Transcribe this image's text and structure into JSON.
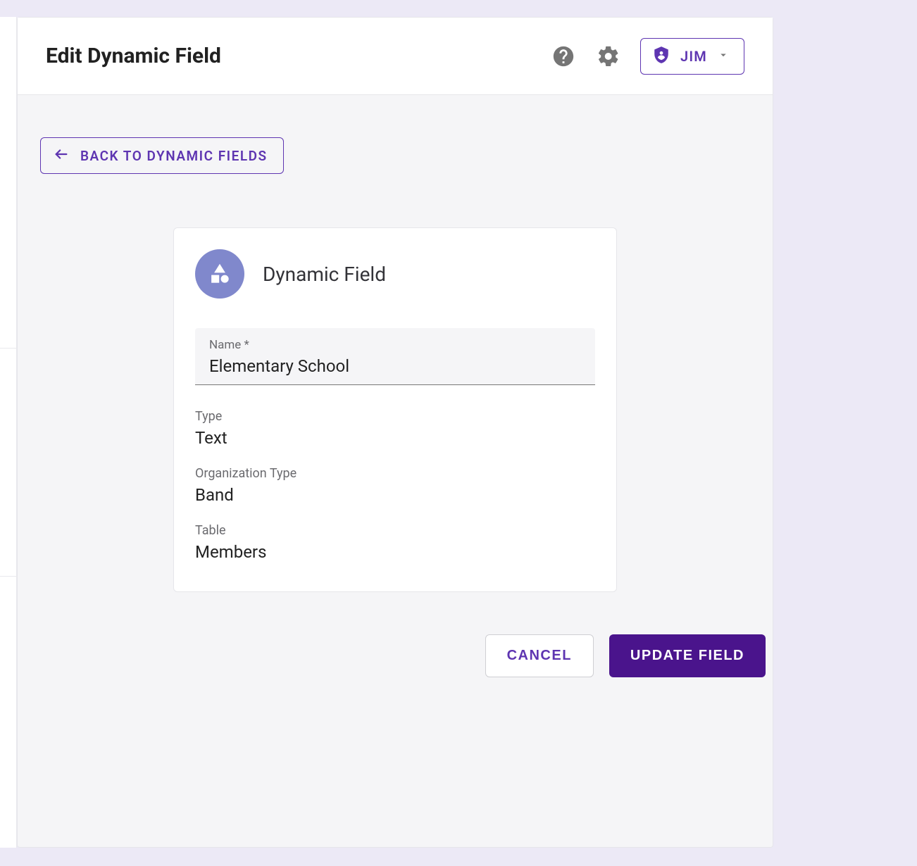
{
  "header": {
    "title": "Edit Dynamic Field",
    "user_name": "JIM"
  },
  "back_button": {
    "label": "BACK TO DYNAMIC FIELDS"
  },
  "card": {
    "title": "Dynamic Field",
    "name_label": "Name *",
    "name_value": "Elementary School",
    "type_label": "Type",
    "type_value": "Text",
    "org_type_label": "Organization Type",
    "org_type_value": "Band",
    "table_label": "Table",
    "table_value": "Members"
  },
  "actions": {
    "cancel": "CANCEL",
    "submit": "UPDATE FIELD"
  },
  "colors": {
    "accent": "#5e35b1",
    "primary_dark": "#4a148c",
    "card_icon_bg": "#8088cc"
  }
}
